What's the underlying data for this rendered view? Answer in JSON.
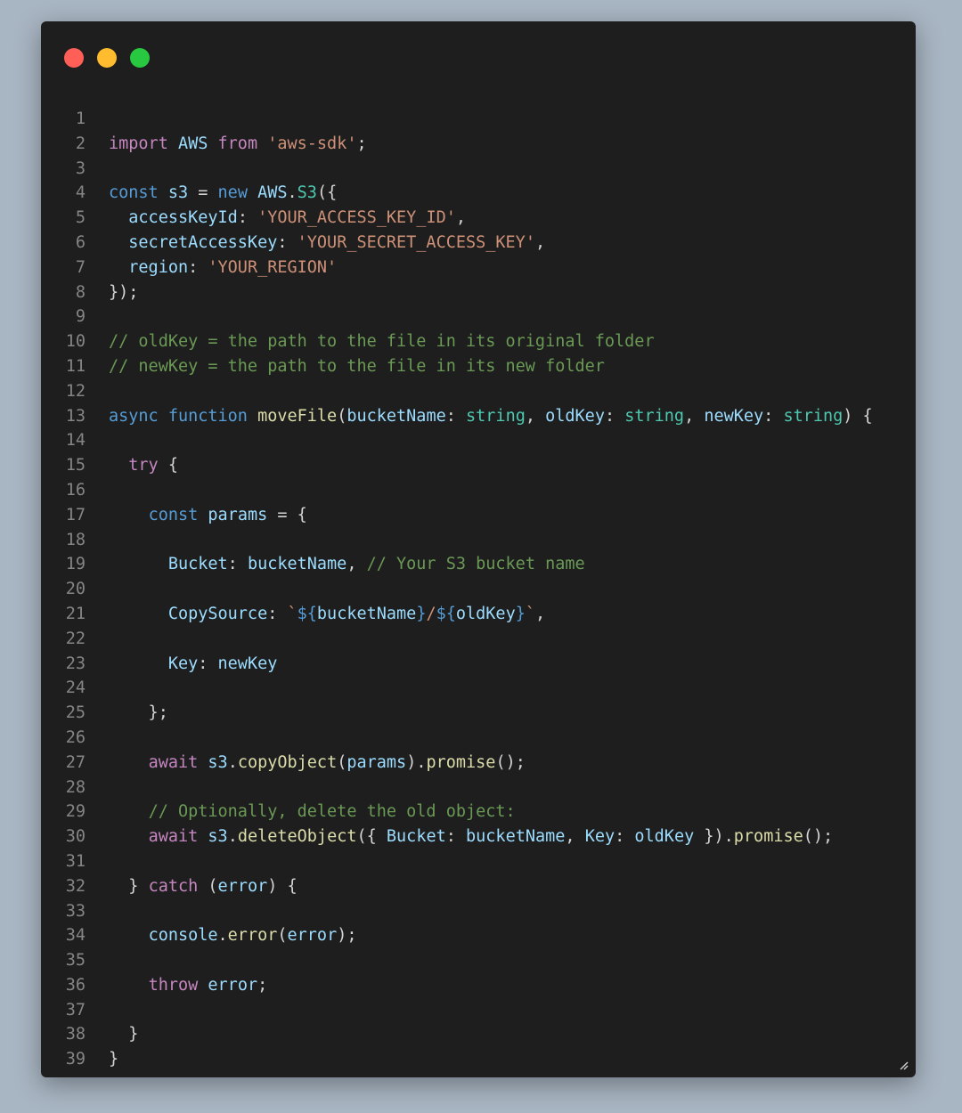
{
  "window": {
    "controls": {
      "close_color": "#ff5f57",
      "minimize_color": "#febc2e",
      "maximize_color": "#28c840"
    }
  },
  "code": {
    "line_numbers": [
      "1",
      "2",
      "3",
      "4",
      "5",
      "6",
      "7",
      "8",
      "9",
      "10",
      "11",
      "12",
      "13",
      "14",
      "15",
      "16",
      "17",
      "18",
      "19",
      "20",
      "21",
      "22",
      "23",
      "24",
      "25",
      "26",
      "27",
      "28",
      "29",
      "30",
      "31",
      "32",
      "33",
      "34",
      "35",
      "36",
      "37",
      "38",
      "39"
    ],
    "lines": [
      [],
      [
        [
          "kw",
          "import"
        ],
        [
          "pun",
          " "
        ],
        [
          "var",
          "AWS"
        ],
        [
          "pun",
          " "
        ],
        [
          "kw",
          "from"
        ],
        [
          "pun",
          " "
        ],
        [
          "str",
          "'aws-sdk'"
        ],
        [
          "pun",
          ";"
        ]
      ],
      [],
      [
        [
          "kd",
          "const"
        ],
        [
          "pun",
          " "
        ],
        [
          "var",
          "s3"
        ],
        [
          "pun",
          " = "
        ],
        [
          "kd",
          "new"
        ],
        [
          "pun",
          " "
        ],
        [
          "var",
          "AWS"
        ],
        [
          "pun",
          "."
        ],
        [
          "cls",
          "S3"
        ],
        [
          "pun",
          "({"
        ]
      ],
      [
        [
          "pun",
          "  "
        ],
        [
          "var",
          "accessKeyId"
        ],
        [
          "pun",
          ": "
        ],
        [
          "str",
          "'YOUR_ACCESS_KEY_ID'"
        ],
        [
          "pun",
          ","
        ]
      ],
      [
        [
          "pun",
          "  "
        ],
        [
          "var",
          "secretAccessKey"
        ],
        [
          "pun",
          ": "
        ],
        [
          "str",
          "'YOUR_SECRET_ACCESS_KEY'"
        ],
        [
          "pun",
          ","
        ]
      ],
      [
        [
          "pun",
          "  "
        ],
        [
          "var",
          "region"
        ],
        [
          "pun",
          ": "
        ],
        [
          "str",
          "'YOUR_REGION'"
        ]
      ],
      [
        [
          "pun",
          "});"
        ]
      ],
      [],
      [
        [
          "com",
          "// oldKey = the path to the file in its original folder"
        ]
      ],
      [
        [
          "com",
          "// newKey = the path to the file in its new folder"
        ]
      ],
      [],
      [
        [
          "kd",
          "async"
        ],
        [
          "pun",
          " "
        ],
        [
          "kd",
          "function"
        ],
        [
          "pun",
          " "
        ],
        [
          "fn",
          "moveFile"
        ],
        [
          "pun",
          "("
        ],
        [
          "var",
          "bucketName"
        ],
        [
          "pun",
          ": "
        ],
        [
          "ty",
          "string"
        ],
        [
          "pun",
          ", "
        ],
        [
          "var",
          "oldKey"
        ],
        [
          "pun",
          ": "
        ],
        [
          "ty",
          "string"
        ],
        [
          "pun",
          ", "
        ],
        [
          "var",
          "newKey"
        ],
        [
          "pun",
          ": "
        ],
        [
          "ty",
          "string"
        ],
        [
          "pun",
          ") {"
        ]
      ],
      [],
      [
        [
          "pun",
          "  "
        ],
        [
          "kw",
          "try"
        ],
        [
          "pun",
          " {"
        ]
      ],
      [],
      [
        [
          "pun",
          "    "
        ],
        [
          "kd",
          "const"
        ],
        [
          "pun",
          " "
        ],
        [
          "var",
          "params"
        ],
        [
          "pun",
          " = {"
        ]
      ],
      [],
      [
        [
          "pun",
          "      "
        ],
        [
          "var",
          "Bucket"
        ],
        [
          "pun",
          ": "
        ],
        [
          "var",
          "bucketName"
        ],
        [
          "pun",
          ", "
        ],
        [
          "com",
          "// Your S3 bucket name"
        ]
      ],
      [],
      [
        [
          "pun",
          "      "
        ],
        [
          "var",
          "CopySource"
        ],
        [
          "pun",
          ": "
        ],
        [
          "str",
          "`"
        ],
        [
          "tmp",
          "${"
        ],
        [
          "var",
          "bucketName"
        ],
        [
          "tmp",
          "}"
        ],
        [
          "str",
          "/"
        ],
        [
          "tmp",
          "${"
        ],
        [
          "var",
          "oldKey"
        ],
        [
          "tmp",
          "}"
        ],
        [
          "str",
          "`"
        ],
        [
          "pun",
          ","
        ]
      ],
      [],
      [
        [
          "pun",
          "      "
        ],
        [
          "var",
          "Key"
        ],
        [
          "pun",
          ": "
        ],
        [
          "var",
          "newKey"
        ]
      ],
      [],
      [
        [
          "pun",
          "    };"
        ]
      ],
      [],
      [
        [
          "pun",
          "    "
        ],
        [
          "kw",
          "await"
        ],
        [
          "pun",
          " "
        ],
        [
          "var",
          "s3"
        ],
        [
          "pun",
          "."
        ],
        [
          "fn",
          "copyObject"
        ],
        [
          "pun",
          "("
        ],
        [
          "var",
          "params"
        ],
        [
          "pun",
          ")."
        ],
        [
          "fn",
          "promise"
        ],
        [
          "pun",
          "();"
        ]
      ],
      [],
      [
        [
          "pun",
          "    "
        ],
        [
          "com",
          "// Optionally, delete the old object:"
        ]
      ],
      [
        [
          "pun",
          "    "
        ],
        [
          "kw",
          "await"
        ],
        [
          "pun",
          " "
        ],
        [
          "var",
          "s3"
        ],
        [
          "pun",
          "."
        ],
        [
          "fn",
          "deleteObject"
        ],
        [
          "pun",
          "({ "
        ],
        [
          "var",
          "Bucket"
        ],
        [
          "pun",
          ": "
        ],
        [
          "var",
          "bucketName"
        ],
        [
          "pun",
          ", "
        ],
        [
          "var",
          "Key"
        ],
        [
          "pun",
          ": "
        ],
        [
          "var",
          "oldKey"
        ],
        [
          "pun",
          " })."
        ],
        [
          "fn",
          "promise"
        ],
        [
          "pun",
          "();"
        ]
      ],
      [],
      [
        [
          "pun",
          "  } "
        ],
        [
          "kw",
          "catch"
        ],
        [
          "pun",
          " ("
        ],
        [
          "var",
          "error"
        ],
        [
          "pun",
          ") {"
        ]
      ],
      [],
      [
        [
          "pun",
          "    "
        ],
        [
          "var",
          "console"
        ],
        [
          "pun",
          "."
        ],
        [
          "fn",
          "error"
        ],
        [
          "pun",
          "("
        ],
        [
          "var",
          "error"
        ],
        [
          "pun",
          ");"
        ]
      ],
      [],
      [
        [
          "pun",
          "    "
        ],
        [
          "kw",
          "throw"
        ],
        [
          "pun",
          " "
        ],
        [
          "var",
          "error"
        ],
        [
          "pun",
          ";"
        ]
      ],
      [],
      [
        [
          "pun",
          "  }"
        ]
      ],
      [
        [
          "pun",
          "}"
        ]
      ]
    ]
  }
}
